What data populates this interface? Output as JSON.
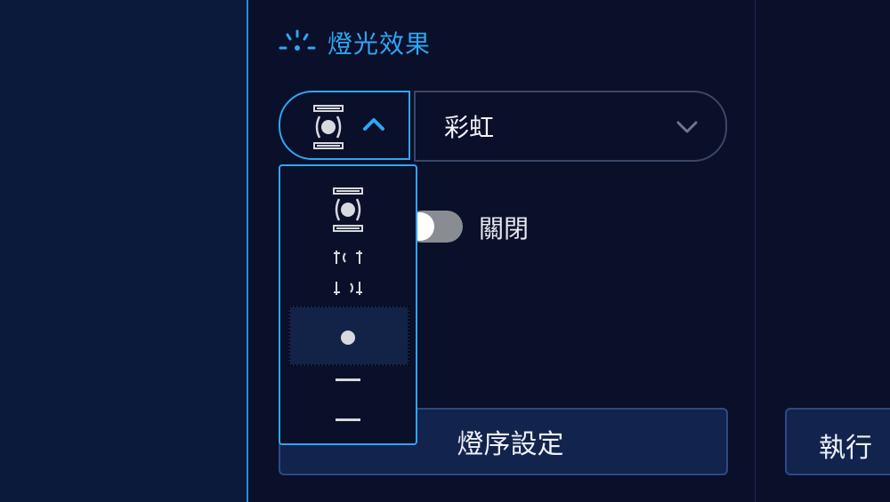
{
  "section": {
    "title": "燈光效果",
    "icon": "light-burst-icon",
    "accent": "#2fa6f2"
  },
  "mode_select": {
    "selected_icon": "beam-focused-icon",
    "expanded": true
  },
  "effect_select": {
    "value": "彩虹"
  },
  "toggle": {
    "label": "關閉",
    "state": "off"
  },
  "dropdown": {
    "options": [
      {
        "icon": "beam-focused-icon"
      },
      {
        "icon": "beam-wide-icon"
      },
      {
        "icon": "dot-icon",
        "highlighted": true
      },
      {
        "icon": "line-short-icon"
      },
      {
        "icon": "line-short-icon"
      }
    ]
  },
  "buttons": {
    "sequence_label": "燈序設定",
    "run_label": "執行"
  }
}
